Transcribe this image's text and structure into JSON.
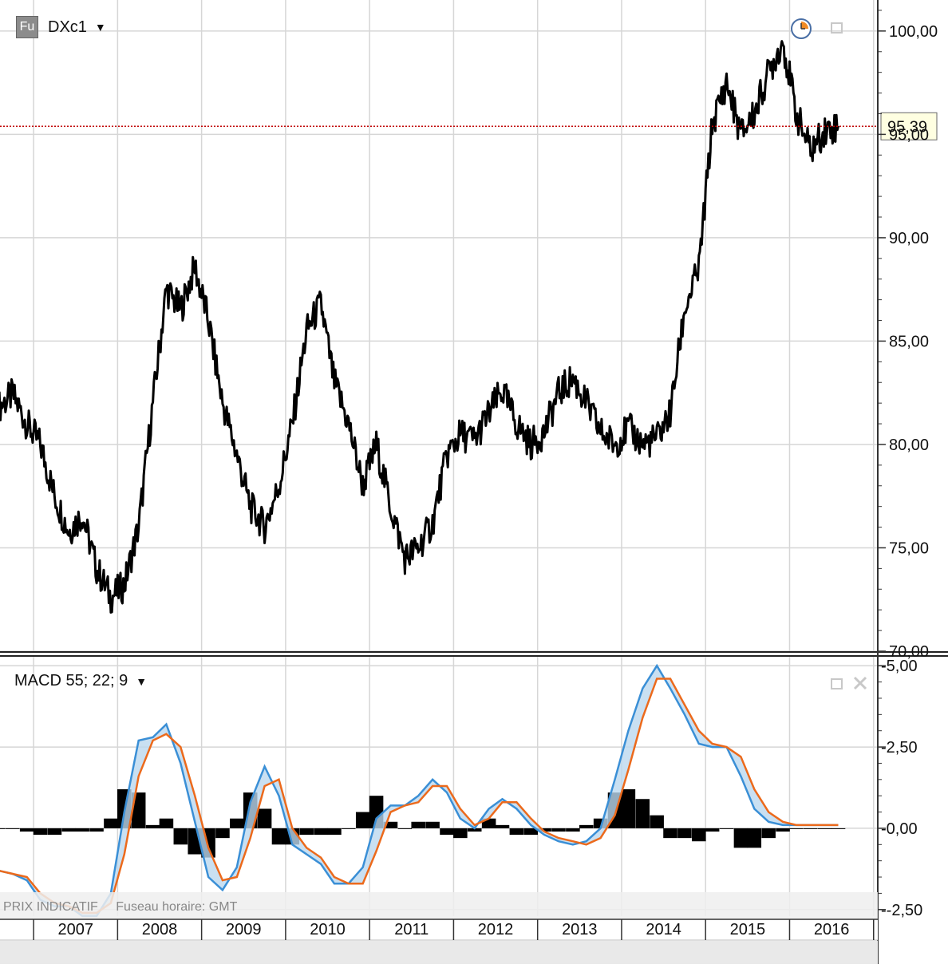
{
  "main_panel": {
    "symbol": "DXc1",
    "symbol_badge": "Fu",
    "last_price_label": "95,39",
    "last_price_value": 95.39,
    "icons": [
      "clock-icon",
      "restore-icon"
    ]
  },
  "macd_panel": {
    "title": "MACD 55; 22; 9",
    "icons": [
      "restore-icon",
      "close-icon"
    ]
  },
  "footer": {
    "note_left": "PRIX INDICATIF",
    "note_right": "Fuseau horaire: GMT"
  },
  "colors": {
    "price_line": "#000000",
    "macd_line": "#3a8fd6",
    "signal_line": "#ec6a1c",
    "fill": "#bcd8ef",
    "histogram": "#000000",
    "last_price_line": "#c00000",
    "grid": "#d6d6d6"
  },
  "chart_data": [
    {
      "type": "line",
      "series": [
        {
          "x": [
            2006.58,
            2006.75,
            2006.92,
            2007.08,
            2007.25,
            2007.42,
            2007.58,
            2007.75,
            2007.92,
            2008.08,
            2008.25,
            2008.42,
            2008.58,
            2008.75,
            2008.92,
            2009.08,
            2009.25,
            2009.42,
            2009.58,
            2009.75,
            2009.92,
            2010.08,
            2010.25,
            2010.42,
            2010.58,
            2010.75,
            2010.92,
            2011.08,
            2011.25,
            2011.42,
            2011.58,
            2011.75,
            2011.92,
            2012.08,
            2012.25,
            2012.42,
            2012.58,
            2012.75,
            2012.92,
            2013.08,
            2013.25,
            2013.42,
            2013.58,
            2013.75,
            2013.92,
            2014.08,
            2014.25,
            2014.42,
            2014.58,
            2014.75,
            2014.92,
            2015.08,
            2015.25,
            2015.42,
            2015.58,
            2015.75,
            2015.92,
            2016.08,
            2016.25,
            2016.42,
            2016.58
          ],
          "values": [
            81.8,
            82.4,
            81.0,
            80.0,
            77.5,
            75.8,
            76.6,
            74.0,
            72.6,
            73.2,
            76.0,
            82.0,
            87.5,
            86.5,
            88.6,
            86.0,
            82.0,
            79.5,
            77.0,
            76.0,
            78.0,
            81.0,
            85.5,
            86.8,
            83.0,
            81.0,
            78.0,
            80.0,
            77.0,
            74.5,
            75.0,
            76.2,
            79.5,
            80.5,
            80.2,
            81.5,
            82.6,
            81.0,
            80.0,
            80.6,
            82.5,
            83.2,
            82.0,
            80.6,
            80.0,
            80.8,
            80.0,
            80.3,
            81.5,
            86.5,
            88.5,
            95.5,
            97.5,
            95.0,
            96.0,
            98.0,
            99.5,
            96.0,
            94.2,
            95.2,
            95.4
          ]
        }
      ],
      "ylim": [
        70,
        101.5
      ],
      "y_ticks": [
        "100,00",
        "95,00",
        "90,00",
        "85,00",
        "80,00",
        "75,00",
        "70,00"
      ],
      "y_tick_values": [
        100,
        95,
        90,
        85,
        80,
        75,
        70
      ],
      "x_ticks": [
        "2007",
        "2008",
        "2009",
        "2010",
        "2011",
        "2012",
        "2013",
        "2014",
        "2015",
        "2016"
      ],
      "x_tick_values": [
        2007,
        2008,
        2009,
        2010,
        2011,
        2012,
        2013,
        2014,
        2015,
        2016
      ],
      "grid": true
    },
    {
      "type": "line",
      "series": [
        {
          "x": [
            2006.58,
            2006.75,
            2006.92,
            2007.08,
            2007.25,
            2007.42,
            2007.58,
            2007.75,
            2007.92,
            2008.08,
            2008.25,
            2008.42,
            2008.58,
            2008.75,
            2008.92,
            2009.08,
            2009.25,
            2009.42,
            2009.58,
            2009.75,
            2009.92,
            2010.08,
            2010.25,
            2010.42,
            2010.58,
            2010.75,
            2010.92,
            2011.08,
            2011.25,
            2011.42,
            2011.58,
            2011.75,
            2011.92,
            2012.08,
            2012.25,
            2012.42,
            2012.58,
            2012.75,
            2012.92,
            2013.08,
            2013.25,
            2013.42,
            2013.58,
            2013.75,
            2013.92,
            2014.08,
            2014.25,
            2014.42,
            2014.58,
            2014.75,
            2014.92,
            2015.08,
            2015.25,
            2015.42,
            2015.58,
            2015.75,
            2015.92,
            2016.08,
            2016.25,
            2016.42,
            2016.58
          ],
          "values": [
            -1.3,
            -1.4,
            -1.6,
            -2.2,
            -2.4,
            -2.4,
            -2.7,
            -2.7,
            -2.0,
            0.5,
            2.7,
            2.8,
            3.2,
            2.0,
            0.2,
            -1.5,
            -1.9,
            -1.2,
            0.8,
            1.9,
            1.0,
            -0.5,
            -0.8,
            -1.1,
            -1.7,
            -1.7,
            -1.2,
            0.3,
            0.7,
            0.7,
            1.0,
            1.5,
            1.1,
            0.3,
            0.0,
            0.6,
            0.9,
            0.6,
            0.1,
            -0.2,
            -0.4,
            -0.5,
            -0.4,
            0.0,
            1.5,
            3.0,
            4.3,
            5.0,
            4.3,
            3.5,
            2.6,
            2.5,
            2.5,
            1.6,
            0.6,
            0.2,
            0.1,
            0.1,
            0.1,
            0.1,
            0.1
          ]
        },
        {
          "x": [
            2006.58,
            2006.75,
            2006.92,
            2007.08,
            2007.25,
            2007.42,
            2007.58,
            2007.75,
            2007.92,
            2008.08,
            2008.25,
            2008.42,
            2008.58,
            2008.75,
            2008.92,
            2009.08,
            2009.25,
            2009.42,
            2009.58,
            2009.75,
            2009.92,
            2010.08,
            2010.25,
            2010.42,
            2010.58,
            2010.75,
            2010.92,
            2011.08,
            2011.25,
            2011.42,
            2011.58,
            2011.75,
            2011.92,
            2012.08,
            2012.25,
            2012.42,
            2012.58,
            2012.75,
            2012.92,
            2013.08,
            2013.25,
            2013.42,
            2013.58,
            2013.75,
            2013.92,
            2014.08,
            2014.25,
            2014.42,
            2014.58,
            2014.75,
            2014.92,
            2015.08,
            2015.25,
            2015.42,
            2015.58,
            2015.75,
            2015.92,
            2016.08,
            2016.25,
            2016.42,
            2016.58
          ],
          "values": [
            -1.3,
            -1.4,
            -1.5,
            -2.0,
            -2.3,
            -2.4,
            -2.6,
            -2.6,
            -2.3,
            -0.8,
            1.6,
            2.7,
            2.9,
            2.5,
            1.0,
            -0.6,
            -1.6,
            -1.5,
            -0.3,
            1.3,
            1.5,
            0.0,
            -0.6,
            -0.9,
            -1.5,
            -1.7,
            -1.7,
            -0.7,
            0.5,
            0.7,
            0.8,
            1.3,
            1.3,
            0.6,
            0.1,
            0.3,
            0.8,
            0.8,
            0.3,
            -0.1,
            -0.3,
            -0.4,
            -0.5,
            -0.3,
            0.4,
            1.8,
            3.4,
            4.6,
            4.6,
            3.8,
            3.0,
            2.6,
            2.5,
            2.2,
            1.2,
            0.5,
            0.2,
            0.1,
            0.1,
            0.1,
            0.1
          ]
        }
      ],
      "histogram": [
        0.0,
        0.0,
        -0.1,
        -0.2,
        -0.2,
        -0.1,
        -0.1,
        -0.1,
        0.3,
        1.2,
        1.1,
        0.1,
        0.3,
        -0.5,
        -0.8,
        -0.9,
        -0.3,
        0.3,
        1.1,
        0.6,
        -0.5,
        -0.5,
        -0.2,
        -0.2,
        -0.2,
        0.0,
        0.5,
        1.0,
        0.2,
        0.0,
        0.2,
        0.2,
        -0.2,
        -0.3,
        -0.1,
        0.3,
        0.1,
        -0.2,
        -0.2,
        -0.1,
        -0.1,
        -0.1,
        0.1,
        0.3,
        1.1,
        1.2,
        0.9,
        0.4,
        -0.3,
        -0.3,
        -0.4,
        -0.1,
        0.0,
        -0.6,
        -0.6,
        -0.3,
        -0.1,
        0.0,
        0.0,
        0.0,
        0.0
      ],
      "ylim": [
        -2.8,
        5.3
      ],
      "y_ticks": [
        "5,00",
        "2,50",
        "0,00",
        "-2,50"
      ],
      "y_tick_values": [
        5,
        2.5,
        0,
        -2.5
      ],
      "grid": true
    }
  ]
}
